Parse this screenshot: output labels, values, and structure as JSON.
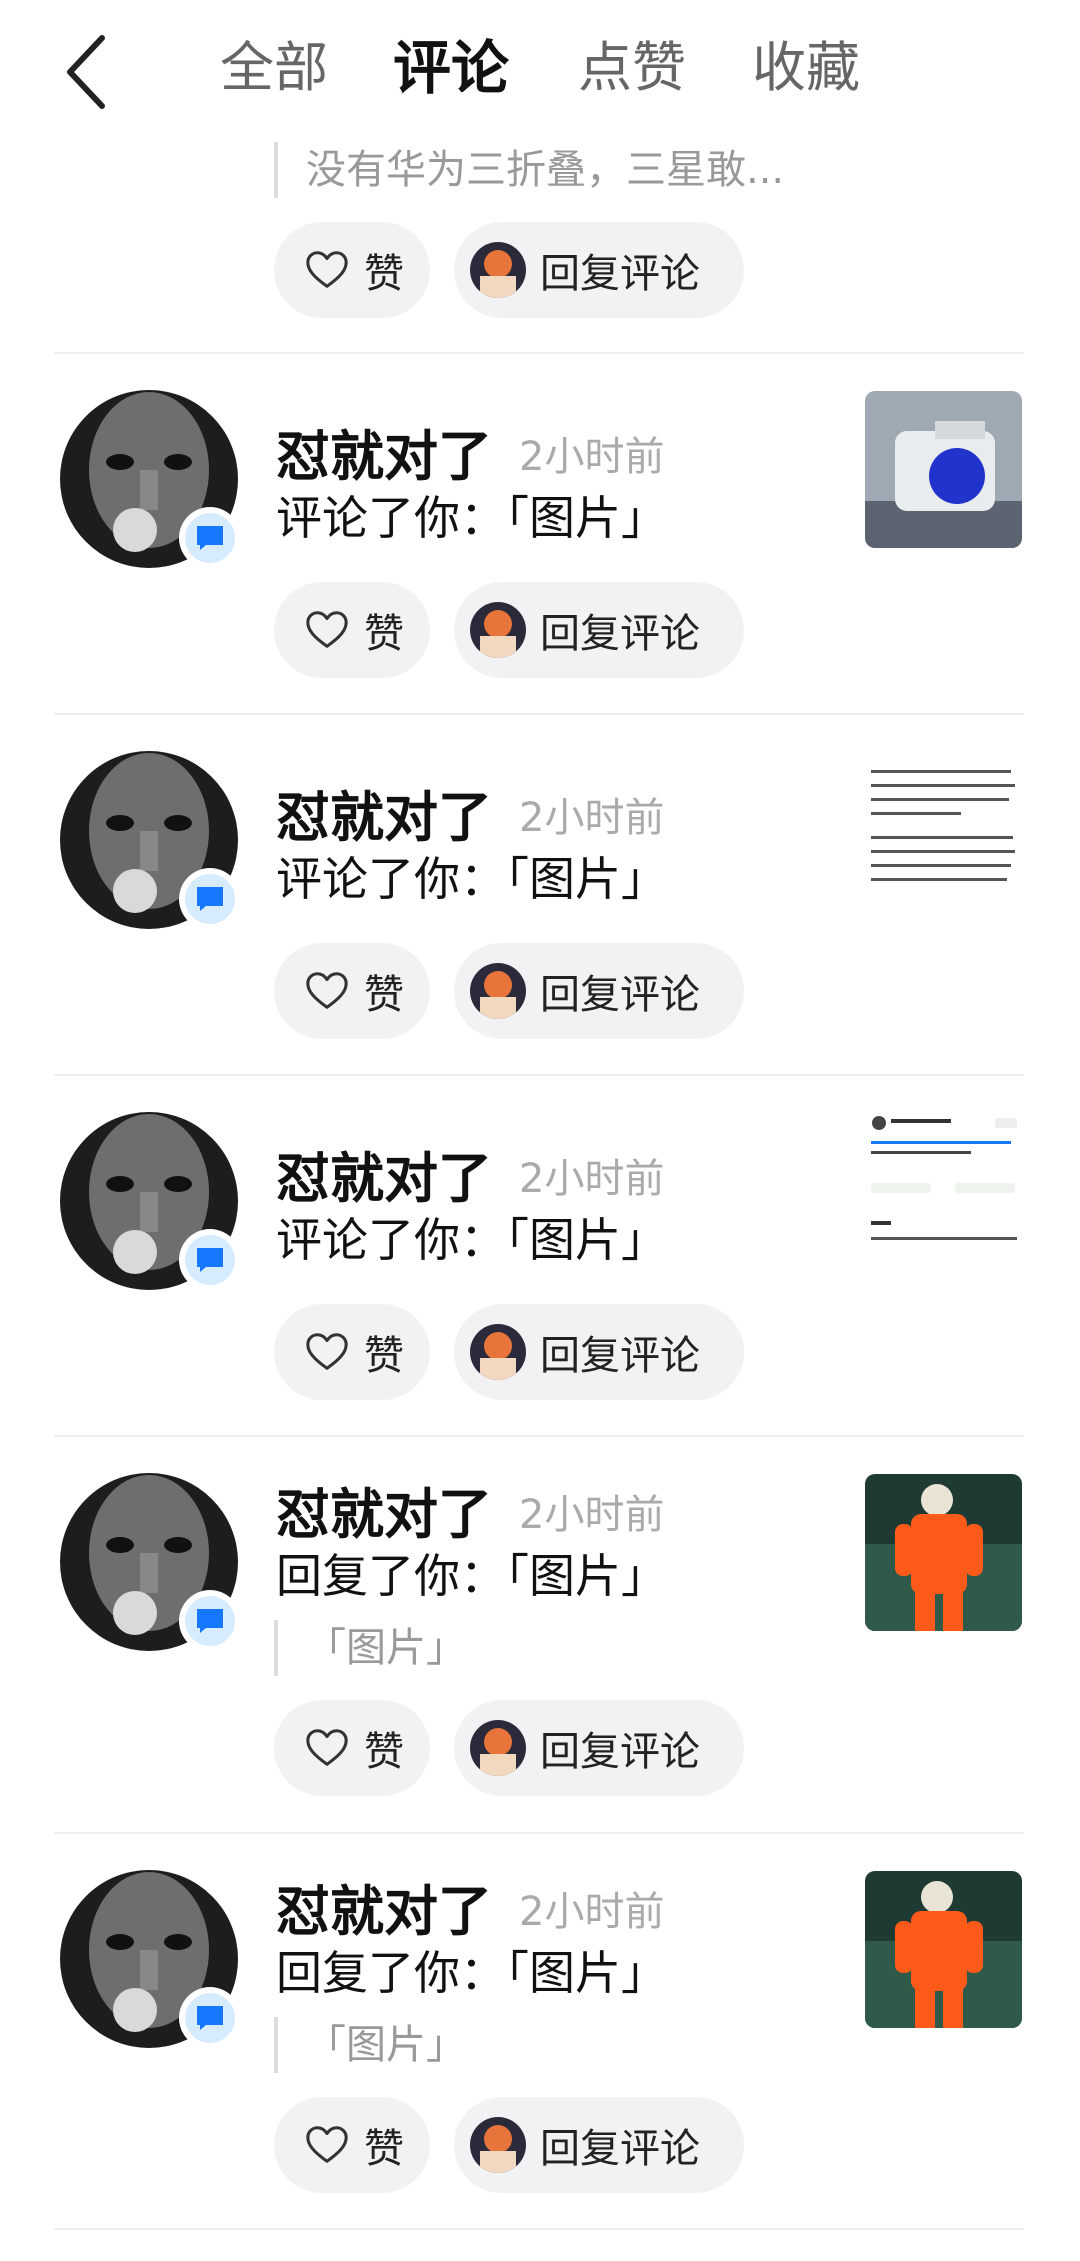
{
  "tabs": {
    "all": "全部",
    "comments": "评论",
    "likes": "点赞",
    "favorites": "收藏",
    "active": "comments"
  },
  "top_partial": {
    "quote": "没有华为三折叠，三星敢..."
  },
  "buttons": {
    "like": "赞",
    "reply": "回复评论"
  },
  "items": [
    {
      "user": "怼就对了",
      "time": "2小时前",
      "action": "评论了你：「图片」",
      "thumb": "weapon-photo"
    },
    {
      "user": "怼就对了",
      "time": "2小时前",
      "action": "评论了你：「图片」",
      "thumb": "text-screenshot"
    },
    {
      "user": "怼就对了",
      "time": "2小时前",
      "action": "评论了你：「图片」",
      "thumb": "post-screenshot"
    },
    {
      "user": "怼就对了",
      "time": "2小时前",
      "action": "回复了你：「图片」",
      "quote": "「图片」",
      "thumb": "worker-photo"
    },
    {
      "user": "怼就对了",
      "time": "2小时前",
      "action": "回复了你：「图片」",
      "quote": "「图片」",
      "thumb": "worker-photo"
    }
  ],
  "colors": {
    "badge_blue": "#1677ff",
    "pill_bg": "#f2f2f4",
    "muted": "#999999"
  }
}
